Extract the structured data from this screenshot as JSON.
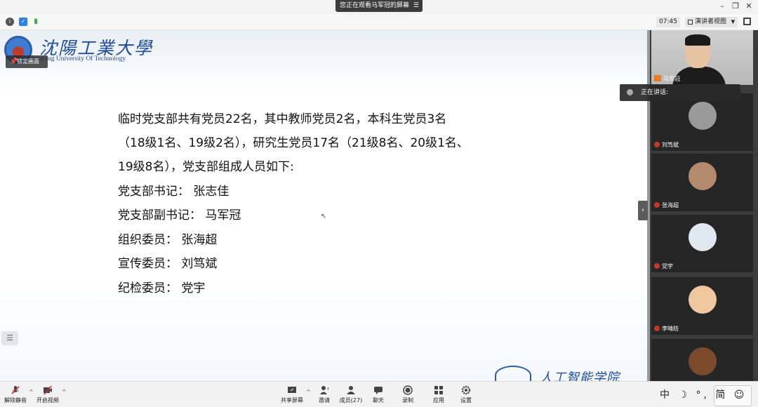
{
  "window": {
    "share_banner": "您正在观看马军冠的屏幕",
    "banner_menu": "☰",
    "minimize": "–",
    "restore": "❐",
    "close": "✕"
  },
  "status": {
    "clock": "07:45",
    "view_mode": "演讲者视图"
  },
  "slide": {
    "university_name_cn": "沈陽工業大學",
    "university_name_en": "Shenyang University Of Technology",
    "lock_screen_label": "锁定画面",
    "lines": [
      "临时党支部共有党员22名，其中教师党员2名，本科生党员3名",
      "（18级1名、19级2名），研究生党员17名（21级8名、20级1名、",
      "19级8名），党支部组成人员如下:",
      "党支部书记：  张志佳",
      "党支部副书记：  马军冠",
      "组织委员：  张海超",
      "宣传委员：  刘笃斌",
      "纪检委员：  党宇"
    ],
    "footer_logo_text": "人工智能学院"
  },
  "participants": {
    "presenter": "马军冠",
    "speaking_label": "正在讲话:",
    "tiles": [
      {
        "name": "刘笃斌",
        "avatar_color": "#9a9a9a"
      },
      {
        "name": "张海超",
        "avatar_color": "#b48a6e"
      },
      {
        "name": "党宇",
        "avatar_color": "#dfe7ef"
      },
      {
        "name": "李晴昉",
        "avatar_color": "#f0c8a0"
      },
      {
        "name": "",
        "avatar_color": "#7a4a2a"
      }
    ]
  },
  "toolbar": {
    "unmute": "解除静音",
    "start_video": "开启视频",
    "share_screen": "共享屏幕",
    "invite": "邀请",
    "members": "成员(27)",
    "chat": "聊天",
    "record": "录制",
    "apps": "应用",
    "settings": "设置",
    "ime": "中 ☽ °, 简 ☺"
  },
  "colors": {
    "accent_blue": "#1e4d9c",
    "panel_bg": "#3c3c3c",
    "mic_muted_red": "#c0392b"
  }
}
